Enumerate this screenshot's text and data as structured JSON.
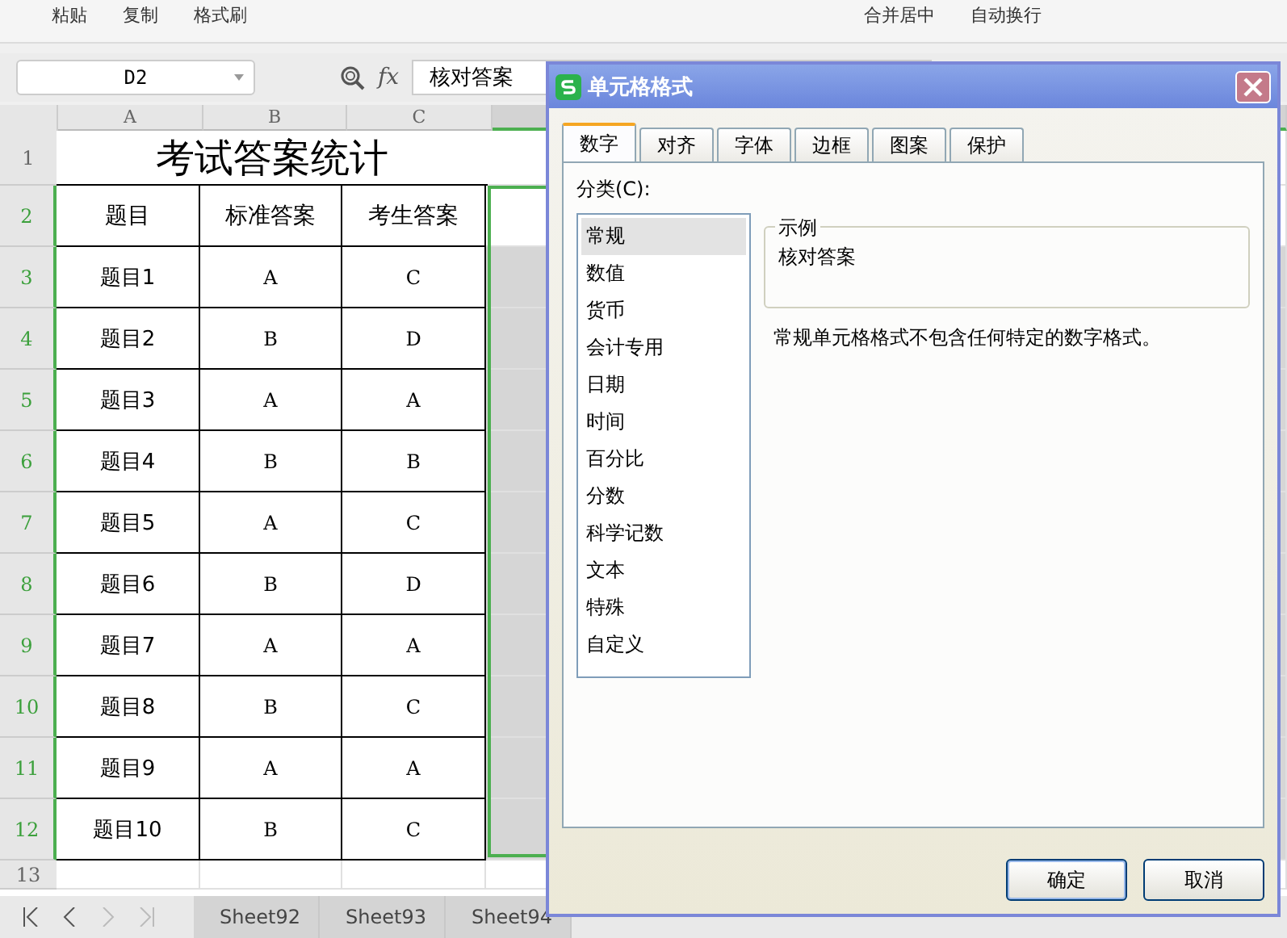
{
  "toolbar": {
    "items": [
      "粘贴",
      "复制",
      "格式刷",
      "合并居中",
      "自动换行"
    ]
  },
  "formula_bar": {
    "cell_ref": "D2",
    "fx": "fx",
    "value": "核对答案"
  },
  "sheet": {
    "columns": [
      "A",
      "B",
      "C",
      ""
    ],
    "title_row": {
      "number": "1",
      "text": "考试答案统计"
    },
    "rows": [
      {
        "number": "2",
        "selected": true,
        "cells": [
          "题目",
          "标准答案",
          "考生答案"
        ]
      },
      {
        "number": "3",
        "selected": true,
        "cells": [
          "题目1",
          "A",
          "C"
        ]
      },
      {
        "number": "4",
        "selected": true,
        "cells": [
          "题目2",
          "B",
          "D"
        ]
      },
      {
        "number": "5",
        "selected": true,
        "cells": [
          "题目3",
          "A",
          "A"
        ]
      },
      {
        "number": "6",
        "selected": true,
        "cells": [
          "题目4",
          "B",
          "B"
        ]
      },
      {
        "number": "7",
        "selected": true,
        "cells": [
          "题目5",
          "A",
          "C"
        ]
      },
      {
        "number": "8",
        "selected": true,
        "cells": [
          "题目6",
          "B",
          "D"
        ]
      },
      {
        "number": "9",
        "selected": true,
        "cells": [
          "题目7",
          "A",
          "A"
        ]
      },
      {
        "number": "10",
        "selected": true,
        "cells": [
          "题目8",
          "B",
          "C"
        ]
      },
      {
        "number": "11",
        "selected": true,
        "cells": [
          "题目9",
          "A",
          "A"
        ]
      },
      {
        "number": "12",
        "selected": true,
        "cells": [
          "题目10",
          "B",
          "C"
        ]
      },
      {
        "number": "13",
        "selected": false,
        "cells": [
          "",
          "",
          ""
        ]
      }
    ]
  },
  "sheet_tabs": [
    {
      "label": "Sheet92",
      "selected": false
    },
    {
      "label": "Sheet93",
      "selected": false
    },
    {
      "label": "Sheet94",
      "selected": false
    }
  ],
  "dialog": {
    "title": "单元格格式",
    "tabs": [
      {
        "label": "数字",
        "selected": true
      },
      {
        "label": "对齐",
        "selected": false
      },
      {
        "label": "字体",
        "selected": false
      },
      {
        "label": "边框",
        "selected": false
      },
      {
        "label": "图案",
        "selected": false
      },
      {
        "label": "保护",
        "selected": false
      }
    ],
    "category_label": "分类(C):",
    "categories": [
      {
        "label": "常规",
        "selected": true
      },
      {
        "label": "数值",
        "selected": false
      },
      {
        "label": "货币",
        "selected": false
      },
      {
        "label": "会计专用",
        "selected": false
      },
      {
        "label": "日期",
        "selected": false
      },
      {
        "label": "时间",
        "selected": false
      },
      {
        "label": "百分比",
        "selected": false
      },
      {
        "label": "分数",
        "selected": false
      },
      {
        "label": "科学记数",
        "selected": false
      },
      {
        "label": "文本",
        "selected": false
      },
      {
        "label": "特殊",
        "selected": false
      },
      {
        "label": "自定义",
        "selected": false
      }
    ],
    "sample_label": "示例",
    "sample_value": "核对答案",
    "description": "常规单元格格式不包含任何特定的数字格式。",
    "buttons": [
      "确定",
      "取消"
    ]
  }
}
